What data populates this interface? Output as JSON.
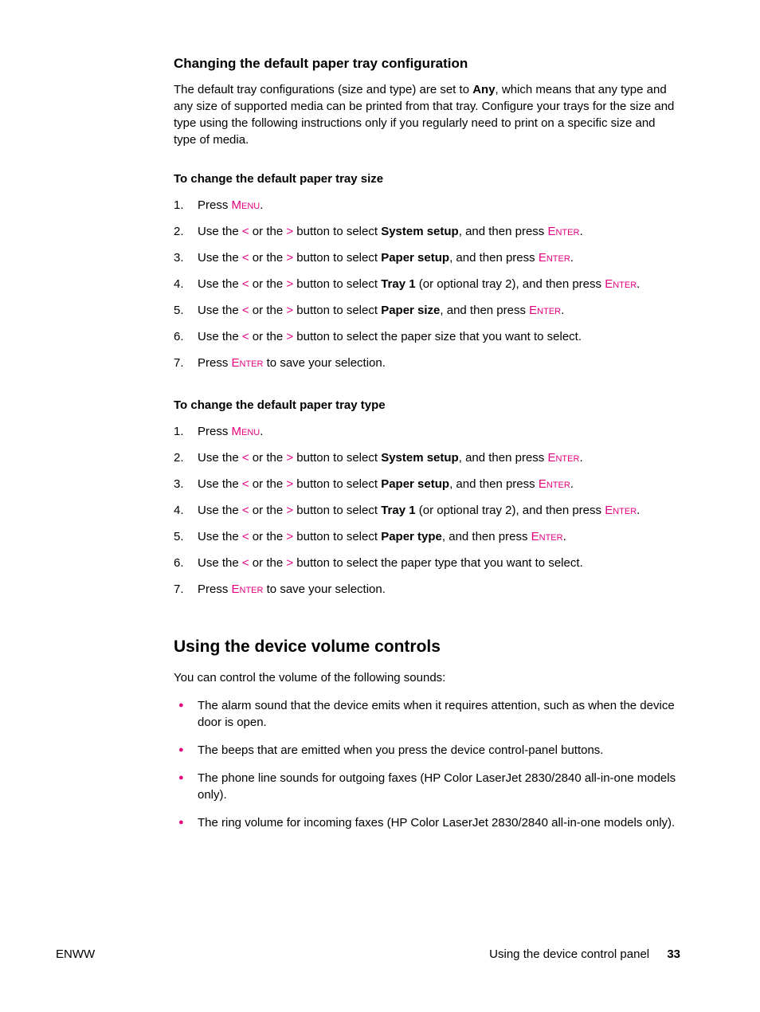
{
  "section1": {
    "heading": "Changing the default paper tray configuration",
    "intro_pre": "The default tray configurations (size and type) are set to ",
    "intro_bold": "Any",
    "intro_post": ", which means that any type and any size of supported media can be printed from that tray. Configure your trays for the size and type using the following instructions only if you regularly need to print on a specific size and type of media."
  },
  "subA": {
    "heading": "To change the default paper tray size",
    "step1_pre": "Press ",
    "step1_menu": "Menu",
    "step1_post": ".",
    "step2_pre": "Use the ",
    "lt": "<",
    "mid": " or the ",
    "gt": ">",
    "step2_mid2": " button to select ",
    "step2_bold": "System setup",
    "step2_post": ", and then press ",
    "enter": "Enter",
    "step2_end": ".",
    "step3_bold": "Paper setup",
    "step4_bold": "Tray 1",
    "step4_paren": " (or optional tray 2), and then press ",
    "step5_bold": "Paper size",
    "step6_post": " button to select the paper size that you want to select.",
    "step7_pre": "Press ",
    "step7_post": " to save your selection."
  },
  "subB": {
    "heading": "To change the default paper tray type",
    "step5_bold": "Paper type",
    "step6_post": " button to select the paper type that you want to select."
  },
  "section2": {
    "heading": "Using the device volume controls",
    "intro": "You can control the volume of the following sounds:",
    "b1": "The alarm sound that the device emits when it requires attention, such as when the device door is open.",
    "b2": "The beeps that are emitted when you press the device control-panel buttons.",
    "b3": "The phone line sounds for outgoing faxes (HP Color LaserJet 2830/2840 all-in-one models only).",
    "b4": "The ring volume for incoming faxes (HP Color LaserJet 2830/2840 all-in-one models only)."
  },
  "footer": {
    "left": "ENWW",
    "right": "Using the device control panel",
    "page": "33"
  }
}
